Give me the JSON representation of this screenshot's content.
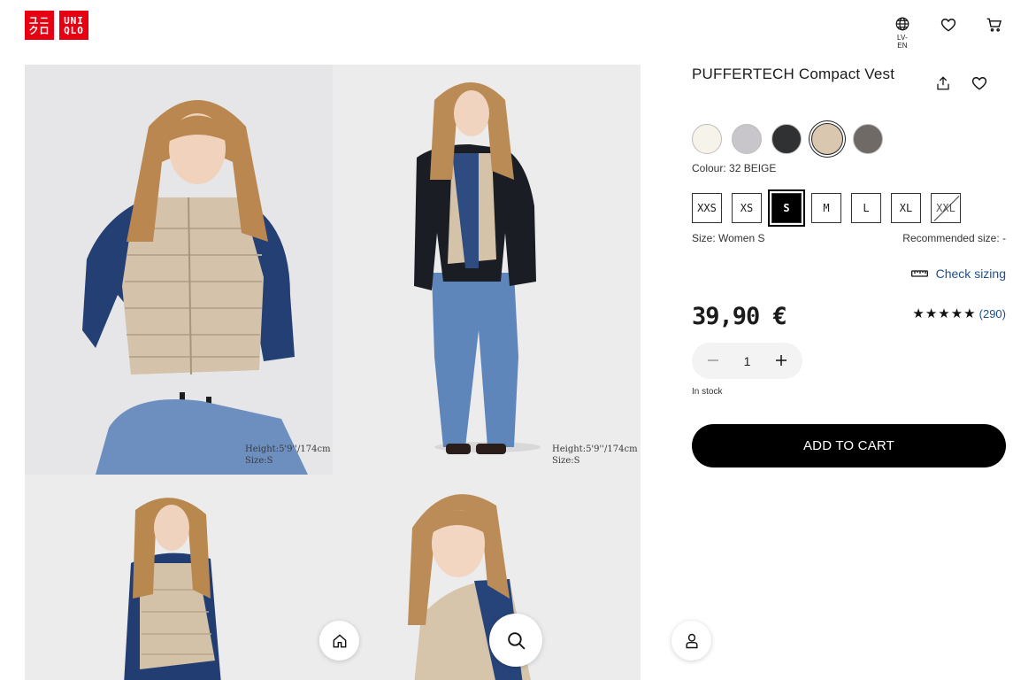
{
  "header": {
    "logo_top": [
      "ユニ",
      "クロ"
    ],
    "logo_bottom": [
      "UNI",
      "QLO"
    ],
    "language_label": "LV-EN",
    "icons": [
      "globe-icon",
      "heart-icon",
      "cart-icon"
    ]
  },
  "gallery": {
    "photos": [
      {
        "caption_height": "Height:5'9''/174cm",
        "caption_size": "Size:S"
      },
      {
        "caption_height": "Height:5'9''/174cm",
        "caption_size": "Size:S"
      },
      {},
      {}
    ]
  },
  "floating_nav": [
    "home-icon",
    "search-icon",
    "account-icon"
  ],
  "product": {
    "title": "PUFFERTECH Compact Vest",
    "colours": [
      {
        "hex": "#f6f3ea"
      },
      {
        "hex": "#c9c6cb"
      },
      {
        "hex": "#2f3132"
      },
      {
        "hex": "#d9c7b0",
        "selected": true
      },
      {
        "hex": "#6f6a66"
      }
    ],
    "colour_label": "Colour: 32 BEIGE",
    "sizes": [
      {
        "label": "XXS"
      },
      {
        "label": "XS"
      },
      {
        "label": "S",
        "selected": true
      },
      {
        "label": "M"
      },
      {
        "label": "L"
      },
      {
        "label": "XL"
      },
      {
        "label": "XXL",
        "unavailable": true
      }
    ],
    "size_label": "Size: Women S",
    "recommended_size": "Recommended size: -",
    "check_sizing": "Check sizing",
    "price": "39,90 €",
    "stars": "★★★★★",
    "rating_count": "(290)",
    "quantity": "1",
    "stock_status": "In stock",
    "add_to_cart": "ADD TO CART"
  },
  "colors": {
    "brand_red": "#e60012",
    "link_blue": "#1e4f8c",
    "cart_button": "#000000"
  }
}
